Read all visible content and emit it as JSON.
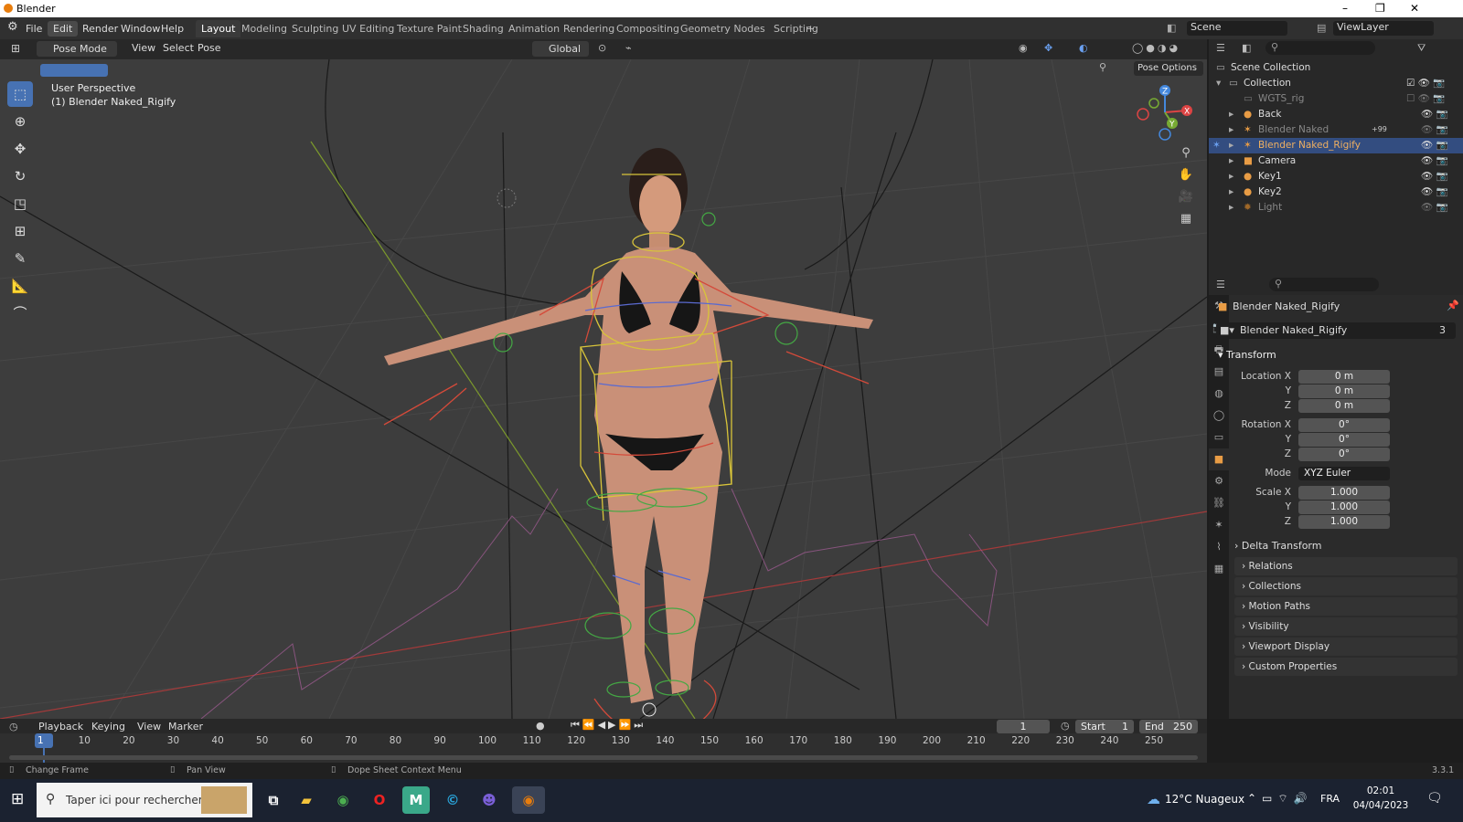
{
  "window": {
    "title": "Blender",
    "minimize": "–",
    "maximize": "❐",
    "close": "✕"
  },
  "menu": [
    "File",
    "Edit",
    "Render",
    "Window",
    "Help"
  ],
  "workspaces": [
    "Layout",
    "Modeling",
    "Sculpting",
    "UV Editing",
    "Texture Paint",
    "Shading",
    "Animation",
    "Rendering",
    "Compositing",
    "Geometry Nodes",
    "Scripting",
    "+"
  ],
  "scene": {
    "label": "Scene",
    "viewlayer": "ViewLayer"
  },
  "viewport_header": {
    "mode": "Pose Mode",
    "view": "View",
    "select": "Select",
    "pose": "Pose",
    "orientation": "Global",
    "pose_options": "Pose Options"
  },
  "viewport": {
    "perspective": "User Perspective",
    "object": "(1) Blender Naked_Rigify",
    "gizmo": {
      "x": "X",
      "y": "Y",
      "z": "Z"
    }
  },
  "outliner": {
    "root": "Scene Collection",
    "collection": "Collection",
    "items": [
      {
        "name": "WGTS_rig",
        "dim": true
      },
      {
        "name": "Back",
        "dim": false
      },
      {
        "name": "Blender Naked",
        "dim": true,
        "badge": "+99"
      },
      {
        "name": "Blender Naked_Rigify",
        "dim": false,
        "selected": true
      },
      {
        "name": "Camera",
        "dim": false
      },
      {
        "name": "Key1",
        "dim": false
      },
      {
        "name": "Key2",
        "dim": false
      },
      {
        "name": "Light",
        "dim": true
      }
    ]
  },
  "properties": {
    "object_name": "Blender Naked_Rigify",
    "datablock": "Blender Naked_Rigify",
    "users": "3",
    "transform": {
      "header": "Transform",
      "location_label": "Location X",
      "rotation_label": "Rotation X",
      "scale_label": "Scale X",
      "y": "Y",
      "z": "Z",
      "location": [
        "0 m",
        "0 m",
        "0 m"
      ],
      "rotation": [
        "0°",
        "0°",
        "0°"
      ],
      "mode_label": "Mode",
      "mode": "XYZ Euler",
      "scale": [
        "1.000",
        "1.000",
        "1.000"
      ]
    },
    "delta": "Delta Transform",
    "panels": [
      "Relations",
      "Collections",
      "Motion Paths",
      "Visibility",
      "Viewport Display",
      "Custom Properties"
    ]
  },
  "timeline": {
    "menus": [
      "Playback",
      "Keying",
      "View",
      "Marker"
    ],
    "current_frame": "1",
    "start_label": "Start",
    "start": "1",
    "end_label": "End",
    "end": "250",
    "ticks": [
      "1",
      "10",
      "20",
      "30",
      "40",
      "50",
      "60",
      "70",
      "80",
      "90",
      "100",
      "110",
      "120",
      "130",
      "140",
      "150",
      "160",
      "170",
      "180",
      "190",
      "200",
      "210",
      "220",
      "230",
      "240",
      "250"
    ]
  },
  "statusbar": {
    "change_frame": "Change Frame",
    "pan_view": "Pan View",
    "context_menu": "Dope Sheet Context Menu",
    "version": "3.3.1"
  },
  "taskbar": {
    "search": "Taper ici pour rechercher",
    "weather": "12°C Nuageux",
    "lang": "FRA",
    "time": "02:01",
    "date": "04/04/2023"
  }
}
